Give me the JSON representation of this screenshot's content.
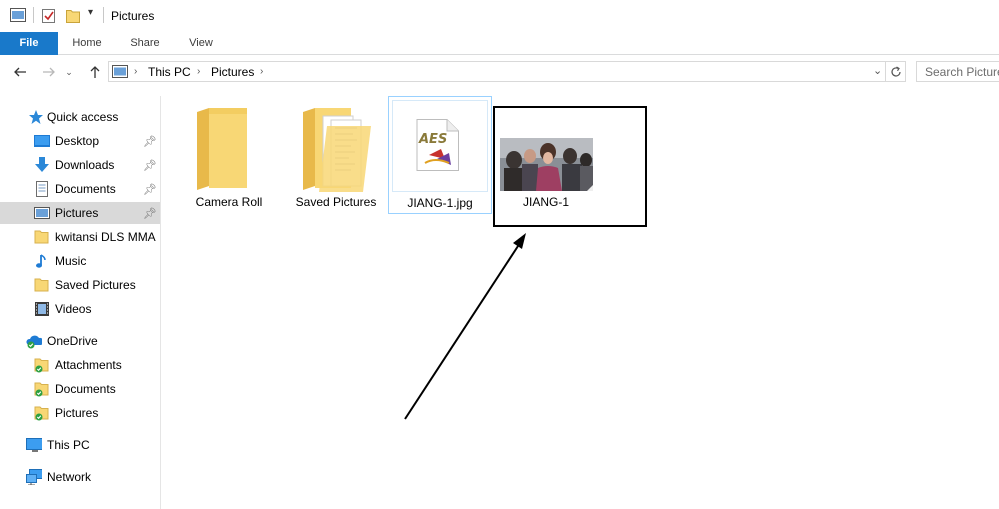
{
  "window": {
    "title": "Pictures"
  },
  "ribbon": {
    "tabs": [
      {
        "label": "File"
      },
      {
        "label": "Home"
      },
      {
        "label": "Share"
      },
      {
        "label": "View"
      }
    ]
  },
  "address": {
    "breadcrumbs": [
      "This PC",
      "Pictures"
    ]
  },
  "search": {
    "placeholder": "Search Pictures"
  },
  "nav": {
    "quick_access": "Quick access",
    "items": [
      {
        "label": "Desktop",
        "icon": "desktop-icon",
        "pinned": true
      },
      {
        "label": "Downloads",
        "icon": "downloads-icon",
        "pinned": true
      },
      {
        "label": "Documents",
        "icon": "documents-icon",
        "pinned": true
      },
      {
        "label": "Pictures",
        "icon": "pictures-icon",
        "pinned": true,
        "selected": true
      },
      {
        "label": "kwitansi DLS MMA",
        "icon": "folder-icon"
      },
      {
        "label": "Music",
        "icon": "music-icon"
      },
      {
        "label": "Saved Pictures",
        "icon": "folder-icon"
      },
      {
        "label": "Videos",
        "icon": "videos-icon"
      }
    ],
    "onedrive": "OneDrive",
    "onedrive_items": [
      {
        "label": "Attachments"
      },
      {
        "label": "Documents"
      },
      {
        "label": "Pictures"
      }
    ],
    "this_pc": "This PC",
    "network": "Network"
  },
  "files": [
    {
      "name": "Camera Roll",
      "type": "folder"
    },
    {
      "name": "Saved Pictures",
      "type": "folder-with-files"
    },
    {
      "name": "JIANG-1.jpg",
      "type": "aes-file",
      "selected": true,
      "icon_text": "AES"
    },
    {
      "name": "JIANG-1",
      "type": "image-thumbnail"
    }
  ],
  "colors": {
    "accent": "#1979ca",
    "folder": "#f8d775",
    "selection_border": "#99d1ff",
    "selected_nav": "#d9d9d9"
  }
}
